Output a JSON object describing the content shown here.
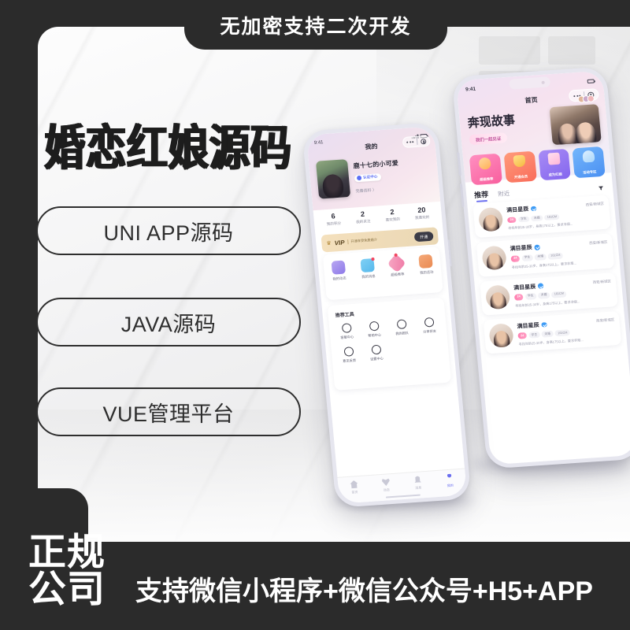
{
  "poster": {
    "top_banner": "无加密支持二次开发",
    "headline": "婚恋红娘源码",
    "pills": [
      "UNI APP源码",
      "JAVA源码",
      "VUE管理平台"
    ],
    "legit_line1": "正规",
    "legit_line2": "公司",
    "bottom_text": "支持微信小程序+微信公众号+H5+APP",
    "colors": {
      "dark": "#2b2b2b",
      "panel": "#f3f3f4",
      "accent_blue": "#6a6ef0",
      "accent_pink": "#f85f9e"
    }
  },
  "phone_left": {
    "status": {
      "time": "9:41"
    },
    "nav_title": "我的",
    "capsule": {
      "more": "more-dots",
      "target": "target-icon"
    },
    "profile": {
      "name": "鹿十七的小可爱",
      "verify_badge": "认证中心",
      "complete_profile": "完善资料 〉"
    },
    "stats": [
      {
        "num": "6",
        "label": "我的积分"
      },
      {
        "num": "2",
        "label": "我的关注"
      },
      {
        "num": "2",
        "label": "喜欢我的"
      },
      {
        "num": "20",
        "label": "我喜欢的"
      }
    ],
    "vip": {
      "word": "VIP",
      "sub": "开通享受免费婚介",
      "button": "开通"
    },
    "grid": [
      {
        "label": "我的动态",
        "icon": "dynamic-icon"
      },
      {
        "label": "我的消息",
        "icon": "message-icon"
      },
      {
        "label": "超级推荐",
        "icon": "super-recommend-icon"
      },
      {
        "label": "我的活动",
        "icon": "activity-icon"
      }
    ],
    "tools_title": "推荐工具",
    "tools": [
      {
        "label": "客服中心",
        "icon": "headset-icon"
      },
      {
        "label": "帮助中心",
        "icon": "question-icon"
      },
      {
        "label": "我的团队",
        "icon": "team-icon"
      },
      {
        "label": "分享好友",
        "icon": "share-icon"
      },
      {
        "label": "意见反馈",
        "icon": "feedback-icon"
      },
      {
        "label": "设置中心",
        "icon": "settings-icon"
      }
    ],
    "tabbar": [
      {
        "label": "首页",
        "icon": "home-icon",
        "active": false
      },
      {
        "label": "动态",
        "icon": "heart-icon",
        "active": false
      },
      {
        "label": "消息",
        "icon": "bell-icon",
        "active": false
      },
      {
        "label": "我的",
        "icon": "person-icon",
        "active": true
      }
    ]
  },
  "phone_right": {
    "status": {
      "time": "9:41"
    },
    "nav_title": "首页",
    "capsule": {
      "more": "more-dots",
      "target": "target-icon"
    },
    "banner": {
      "title": "奔现故事",
      "subtitle": "我们一起见证"
    },
    "categories": [
      {
        "label": "超级推荐",
        "icon": "heart-gift-icon"
      },
      {
        "label": "开通会员",
        "icon": "member-badge-icon"
      },
      {
        "label": "成为红娘",
        "icon": "matchmaker-icon"
      },
      {
        "label": "活动专区",
        "icon": "trophy-icon"
      }
    ],
    "tabs": [
      {
        "label": "推荐",
        "active": true
      },
      {
        "label": "附近",
        "active": false
      }
    ],
    "filter_icon": "filter-icon",
    "list": [
      {
        "name": "满目星辰",
        "verified": true,
        "location": "西安/新城区",
        "tags": [
          "24",
          "学生",
          "未婚",
          "161CM"
        ],
        "desc": "寻找年龄25-30岁，身高175以上，要求非烟..."
      },
      {
        "name": "满目星辰",
        "verified": true,
        "location": "西安/新城区",
        "tags": [
          "24",
          "学生",
          "未婚",
          "161CM"
        ],
        "desc": "寻找年龄25-30岁，身高175以上，要求非烟..."
      },
      {
        "name": "满目星辰",
        "verified": true,
        "location": "西安/新城区",
        "tags": [
          "24",
          "学生",
          "未婚",
          "161CM"
        ],
        "desc": "寻找年龄25-30岁，身高175以上，要求非烟..."
      },
      {
        "name": "满目星辰",
        "verified": true,
        "location": "西安/新城区",
        "tags": [
          "24",
          "学生",
          "未婚",
          "161CM"
        ],
        "desc": "寻找年龄25-30岁，身高175以上，要求非烟..."
      }
    ]
  }
}
